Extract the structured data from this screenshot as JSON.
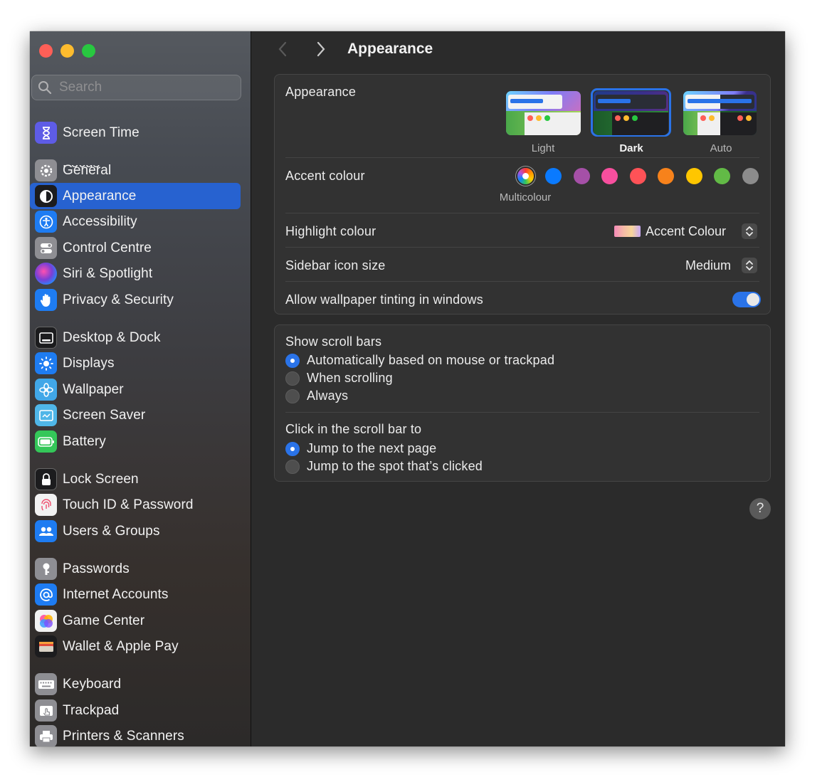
{
  "window": {
    "title": "Appearance"
  },
  "sidebar": {
    "search_placeholder": "Search",
    "clipped_item": {
      "label": "Focus",
      "icon": "moon-icon"
    },
    "items": [
      {
        "label": "Screen Time",
        "icon": "hourglass-icon",
        "color": "#5e5ce6"
      },
      {
        "label": "General",
        "icon": "gear-icon",
        "color": "#8e8e93"
      },
      {
        "label": "Appearance",
        "icon": "appearance-icon",
        "color": "#1c1c1e",
        "selected": true
      },
      {
        "label": "Accessibility",
        "icon": "accessibility-icon",
        "color": "#1e7cf2"
      },
      {
        "label": "Control Centre",
        "icon": "control-centre-icon",
        "color": "#8e8e93"
      },
      {
        "label": "Siri & Spotlight",
        "icon": "siri-icon",
        "color": "#7a3fd6"
      },
      {
        "label": "Privacy & Security",
        "icon": "hand-icon",
        "color": "#1e7cf2"
      },
      {
        "label": "Desktop & Dock",
        "icon": "dock-icon",
        "color": "#1c1c1e"
      },
      {
        "label": "Displays",
        "icon": "sun-icon",
        "color": "#1e7cf2"
      },
      {
        "label": "Wallpaper",
        "icon": "flower-icon",
        "color": "#41a7e8"
      },
      {
        "label": "Screen Saver",
        "icon": "screen-saver-icon",
        "color": "#4fb6e8"
      },
      {
        "label": "Battery",
        "icon": "battery-icon",
        "color": "#34c759"
      },
      {
        "label": "Lock Screen",
        "icon": "lock-icon",
        "color": "#1c1c1e"
      },
      {
        "label": "Touch ID & Password",
        "icon": "fingerprint-icon",
        "color": "#f2f2f2"
      },
      {
        "label": "Users & Groups",
        "icon": "users-icon",
        "color": "#1e7cf2"
      },
      {
        "label": "Passwords",
        "icon": "key-icon",
        "color": "#8e8e93"
      },
      {
        "label": "Internet Accounts",
        "icon": "at-icon",
        "color": "#1e7cf2"
      },
      {
        "label": "Game Center",
        "icon": "game-center-icon",
        "color": "#f2f2f2"
      },
      {
        "label": "Wallet & Apple Pay",
        "icon": "wallet-icon",
        "color": "#1c1c1e"
      },
      {
        "label": "Keyboard",
        "icon": "keyboard-icon",
        "color": "#8e8e93"
      },
      {
        "label": "Trackpad",
        "icon": "trackpad-icon",
        "color": "#8e8e93"
      },
      {
        "label": "Printers & Scanners",
        "icon": "printer-icon",
        "color": "#8e8e93"
      }
    ]
  },
  "main": {
    "title": "Appearance",
    "appearance_section": {
      "label": "Appearance",
      "options": [
        {
          "label": "Light",
          "selected": false
        },
        {
          "label": "Dark",
          "selected": true
        },
        {
          "label": "Auto",
          "selected": false
        }
      ]
    },
    "accent": {
      "label": "Accent colour",
      "selected_caption": "Multicolour",
      "colors": [
        {
          "name": "Multicolour",
          "hex": "multicolor",
          "selected": true
        },
        {
          "name": "Blue",
          "hex": "#0a7aff"
        },
        {
          "name": "Purple",
          "hex": "#a550a7"
        },
        {
          "name": "Pink",
          "hex": "#f74f9e"
        },
        {
          "name": "Red",
          "hex": "#ff5257"
        },
        {
          "name": "Orange",
          "hex": "#f7821b"
        },
        {
          "name": "Yellow",
          "hex": "#ffc600"
        },
        {
          "name": "Green",
          "hex": "#62ba46"
        },
        {
          "name": "Graphite",
          "hex": "#8c8c8c"
        }
      ]
    },
    "highlight": {
      "label": "Highlight colour",
      "value": "Accent Colour"
    },
    "sidebar_icon_size": {
      "label": "Sidebar icon size",
      "value": "Medium"
    },
    "wallpaper_tinting": {
      "label": "Allow wallpaper tinting in windows",
      "enabled": true
    },
    "scroll_bars": {
      "label": "Show scroll bars",
      "options": [
        {
          "label": "Automatically based on mouse or trackpad",
          "selected": true
        },
        {
          "label": "When scrolling",
          "selected": false
        },
        {
          "label": "Always",
          "selected": false
        }
      ]
    },
    "click_scroll": {
      "label": "Click in the scroll bar to",
      "options": [
        {
          "label": "Jump to the next page",
          "selected": true
        },
        {
          "label": "Jump to the spot that’s clicked",
          "selected": false
        }
      ]
    },
    "help_label": "?"
  }
}
